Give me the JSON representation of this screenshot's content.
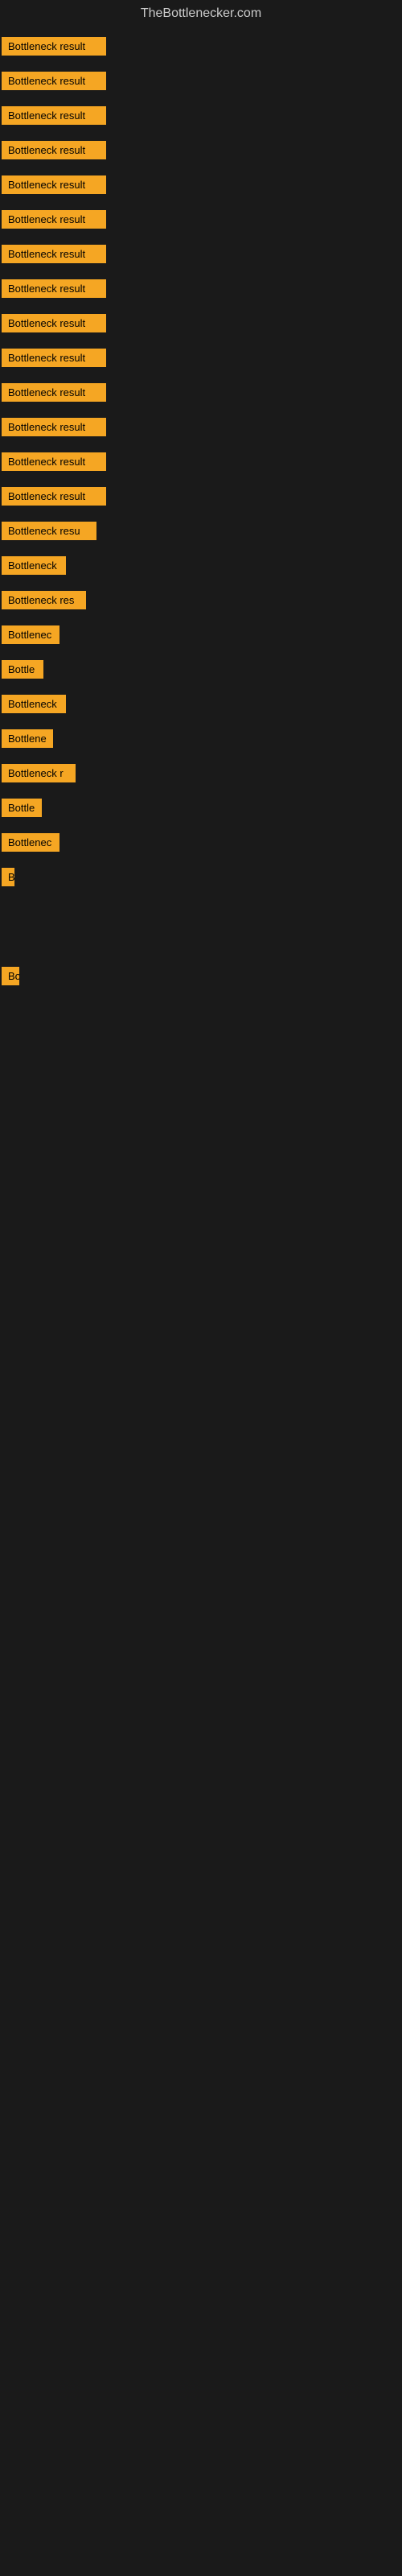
{
  "site": {
    "title": "TheBottlenecker.com"
  },
  "rows": [
    {
      "id": 1,
      "label": "Bottleneck result",
      "width": 130
    },
    {
      "id": 2,
      "label": "Bottleneck result",
      "width": 130
    },
    {
      "id": 3,
      "label": "Bottleneck result",
      "width": 130
    },
    {
      "id": 4,
      "label": "Bottleneck result",
      "width": 130
    },
    {
      "id": 5,
      "label": "Bottleneck result",
      "width": 130
    },
    {
      "id": 6,
      "label": "Bottleneck result",
      "width": 130
    },
    {
      "id": 7,
      "label": "Bottleneck result",
      "width": 130
    },
    {
      "id": 8,
      "label": "Bottleneck result",
      "width": 130
    },
    {
      "id": 9,
      "label": "Bottleneck result",
      "width": 130
    },
    {
      "id": 10,
      "label": "Bottleneck result",
      "width": 130
    },
    {
      "id": 11,
      "label": "Bottleneck result",
      "width": 130
    },
    {
      "id": 12,
      "label": "Bottleneck result",
      "width": 130
    },
    {
      "id": 13,
      "label": "Bottleneck result",
      "width": 130
    },
    {
      "id": 14,
      "label": "Bottleneck result",
      "width": 130
    },
    {
      "id": 15,
      "label": "Bottleneck resu",
      "width": 118
    },
    {
      "id": 16,
      "label": "Bottleneck",
      "width": 80
    },
    {
      "id": 17,
      "label": "Bottleneck res",
      "width": 105
    },
    {
      "id": 18,
      "label": "Bottlenec",
      "width": 72
    },
    {
      "id": 19,
      "label": "Bottle",
      "width": 52
    },
    {
      "id": 20,
      "label": "Bottleneck",
      "width": 80
    },
    {
      "id": 21,
      "label": "Bottlene",
      "width": 64
    },
    {
      "id": 22,
      "label": "Bottleneck r",
      "width": 92
    },
    {
      "id": 23,
      "label": "Bottle",
      "width": 50
    },
    {
      "id": 24,
      "label": "Bottlenec",
      "width": 72
    },
    {
      "id": 25,
      "label": "B",
      "width": 16
    },
    {
      "id": 26,
      "label": "",
      "width": 0
    },
    {
      "id": 27,
      "label": "",
      "width": 0
    },
    {
      "id": 28,
      "label": "",
      "width": 0
    },
    {
      "id": 29,
      "label": "",
      "width": 0
    },
    {
      "id": 30,
      "label": "Bo",
      "width": 22
    },
    {
      "id": 31,
      "label": "",
      "width": 0
    },
    {
      "id": 32,
      "label": "",
      "width": 0
    },
    {
      "id": 33,
      "label": "",
      "width": 0
    },
    {
      "id": 34,
      "label": "",
      "width": 0
    }
  ]
}
